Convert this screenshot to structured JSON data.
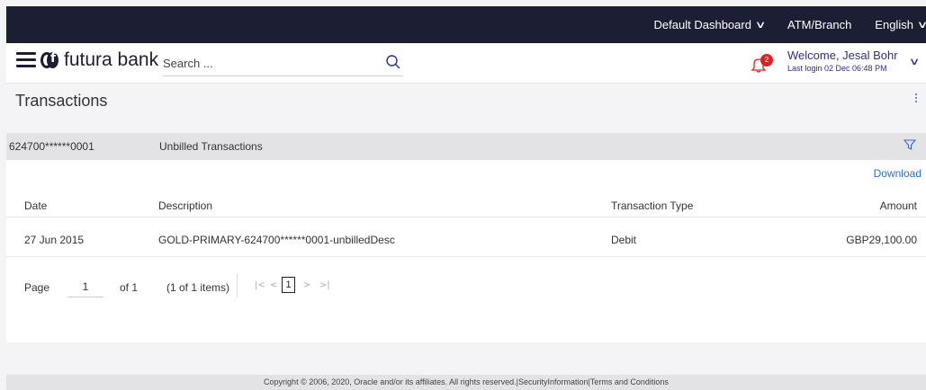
{
  "topbar": {
    "dashboard": "Default Dashboard",
    "atm_branch": "ATM/Branch",
    "language": "English"
  },
  "header": {
    "brand": "futura bank",
    "search_placeholder": "Search ...",
    "notification_count": "2",
    "welcome": "Welcome, Jesal Bohr",
    "last_login": "Last login 02 Dec 06:48 PM"
  },
  "page": {
    "title": "Transactions"
  },
  "card": {
    "account_number": "624700******0001",
    "section_label": "Unbilled Transactions",
    "download_label": "Download"
  },
  "table": {
    "columns": {
      "date": "Date",
      "description": "Description",
      "type": "Transaction Type",
      "amount": "Amount"
    },
    "rows": [
      {
        "date": "27 Jun 2015",
        "description": "GOLD-PRIMARY-624700******0001-unbilledDesc",
        "type": "Debit",
        "amount": "GBP29,100.00"
      }
    ]
  },
  "pager": {
    "page_label": "Page",
    "page_value": "1",
    "of_label": "of 1",
    "items_label": "(1 of 1 items)",
    "first": "|<",
    "prev": "<",
    "current": "1",
    "next": ">",
    "last": ">|"
  },
  "footer": {
    "copyright": "Copyright © 2006, 2020, Oracle and/or its affiliates. All rights reserved.",
    "sep1": "|",
    "security": "SecurityInformation",
    "sep2": "|",
    "terms": "Terms and Conditions"
  },
  "colors": {
    "topbar": "#1c1f33",
    "link": "#2b6ed2",
    "badge": "#dd2222"
  }
}
